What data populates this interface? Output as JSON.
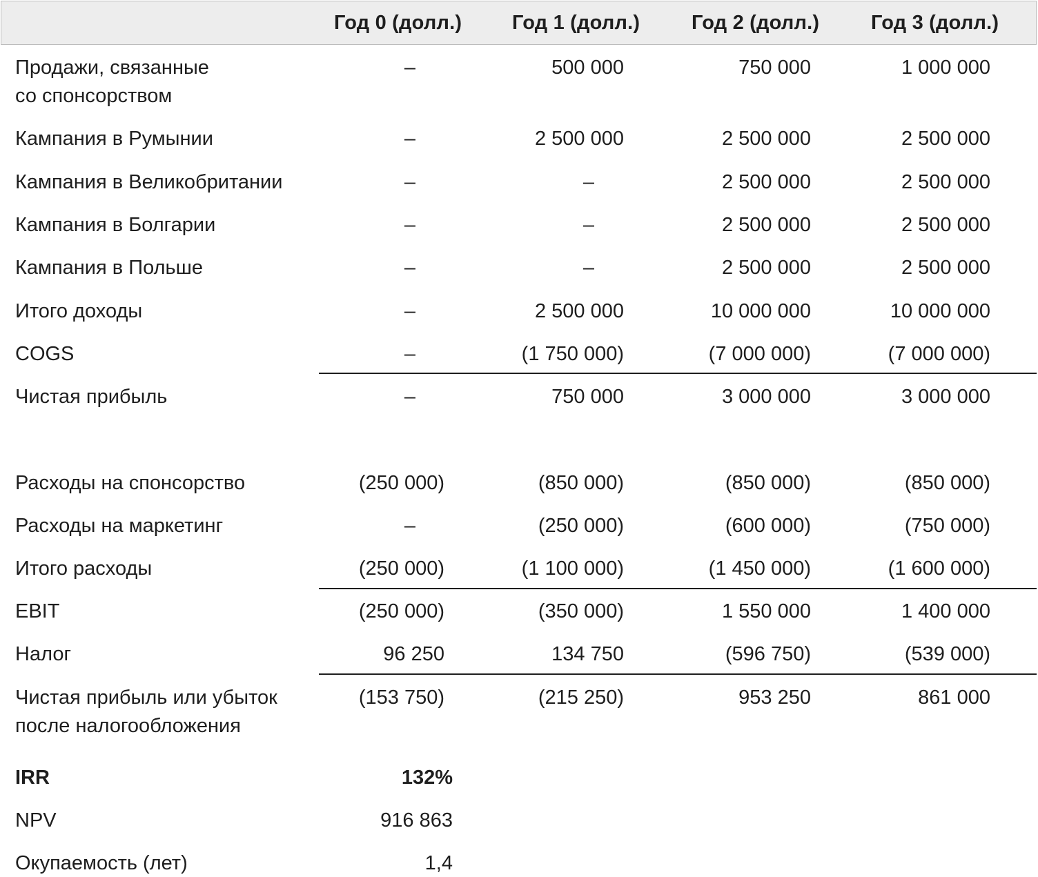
{
  "headers": [
    "",
    "Год 0 (долл.)",
    "Год 1 (долл.)",
    "Год 2 (долл.)",
    "Год 3 (долл.)"
  ],
  "rows": [
    {
      "label_lines": [
        "Продажи, связанные",
        "со спонсорством"
      ],
      "values": [
        "–",
        "500 000",
        "750 000",
        "1 000 000"
      ]
    },
    {
      "label": "Кампания в Румынии",
      "values": [
        "–",
        "2 500 000",
        "2 500 000",
        "2 500 000"
      ]
    },
    {
      "label": "Кампания в Великобритании",
      "values": [
        "–",
        "–",
        "2 500 000",
        "2 500 000"
      ]
    },
    {
      "label": "Кампания в Болгарии",
      "values": [
        "–",
        "–",
        "2 500 000",
        "2 500 000"
      ]
    },
    {
      "label": "Кампания в Польше",
      "values": [
        "–",
        "–",
        "2 500 000",
        "2 500 000"
      ]
    },
    {
      "label": "Итого доходы",
      "values": [
        "–",
        "2 500 000",
        "10 000 000",
        "10 000 000"
      ]
    },
    {
      "label": "COGS",
      "values": [
        "–",
        "(1 750 000)",
        "(7 000 000)",
        "(7 000 000)"
      ]
    },
    {
      "label": "Чистая прибыль",
      "values": [
        "–",
        "750 000",
        "3 000 000",
        "3 000 000"
      ]
    },
    {
      "label": "Расходы на спонсорство",
      "values": [
        "(250 000)",
        "(850 000)",
        "(850 000)",
        "(850 000)"
      ]
    },
    {
      "label": "Расходы на маркетинг",
      "values": [
        "–",
        "(250 000)",
        "(600 000)",
        "(750 000)"
      ]
    },
    {
      "label": "Итого расходы",
      "values": [
        "(250 000)",
        "(1 100 000)",
        "(1 450 000)",
        "(1 600 000)"
      ]
    },
    {
      "label": "EBIT",
      "values": [
        "(250 000)",
        "(350 000)",
        "1 550 000",
        "1 400 000"
      ]
    },
    {
      "label": "Налог",
      "values": [
        "96 250",
        "134 750",
        "(596 750)",
        "(539 000)"
      ]
    },
    {
      "label_lines": [
        "Чистая прибыль или убыток",
        "после налогообложения"
      ],
      "values": [
        "(153 750)",
        "(215 250)",
        "953 250",
        "861 000"
      ]
    }
  ],
  "summary": [
    {
      "label": "IRR",
      "value": "132%"
    },
    {
      "label": "NPV",
      "value": "916 863"
    },
    {
      "label": "Окупаемость (лет)",
      "value": "1,4"
    }
  ]
}
